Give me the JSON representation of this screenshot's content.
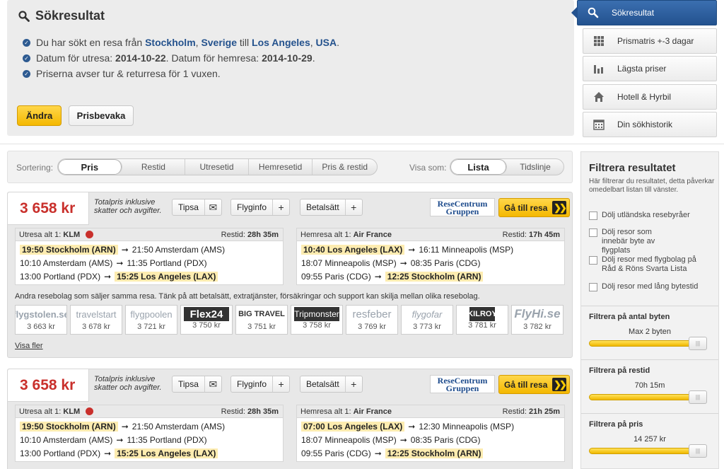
{
  "summary": {
    "title": "Sökresultat",
    "line1": {
      "prefix": "Du har sökt en resa från ",
      "from_city": "Stockholm",
      "comma1": ", ",
      "from_country": "Sverige",
      "mid": " till ",
      "to_city": "Los Angeles",
      "comma2": ", ",
      "to_country": "USA",
      "suffix": "."
    },
    "line2": {
      "prefix": "Datum för utresa: ",
      "out_date": "2014-10-22",
      "mid": ". Datum för hemresa: ",
      "home_date": "2014-10-29",
      "suffix": "."
    },
    "line3": "Priserna avser tur & returresa för 1 vuxen.",
    "change_label": "Ändra",
    "watch_label": "Prisbevaka"
  },
  "nav": [
    {
      "label": "Sökresultat",
      "icon": "search-icon"
    },
    {
      "label": "Prismatris +-3 dagar",
      "icon": "grid-icon"
    },
    {
      "label": "Lägsta priser",
      "icon": "bar-chart-icon"
    },
    {
      "label": "Hotell & Hyrbil",
      "icon": "house-icon"
    },
    {
      "label": "Din sökhistorik",
      "icon": "calendar-icon"
    }
  ],
  "sort": {
    "label": "Sortering:",
    "options": [
      "Pris",
      "Restid",
      "Utresetid",
      "Hemresetid",
      "Pris & restid"
    ],
    "view_label": "Visa som:",
    "view_options": [
      "Lista",
      "Tidslinje"
    ]
  },
  "results": [
    {
      "price": "3 658 kr",
      "note": "Totalpris inklusive skatter och avgifter.",
      "tipsa": "Tipsa",
      "flyginfo": "Flyginfo",
      "betalsatt": "Betalsätt",
      "agency_logo": "ReseCentrum Gruppen",
      "go_label": "Gå till resa",
      "out": {
        "head": "Utresa alt 1:",
        "airline": "KLM",
        "time_label": "Restid:",
        "time": "28h 35m",
        "rows": [
          {
            "dep": "19:50 Stockholm (ARN)",
            "arr": "21:50 Amsterdam (AMS)"
          },
          {
            "dep": "10:10 Amsterdam (AMS)",
            "arr": "11:35 Portland (PDX)"
          },
          {
            "dep": "13:00 Portland (PDX)",
            "arr": "15:25 Los Angeles (LAX)"
          }
        ]
      },
      "home": {
        "head": "Hemresa alt 1:",
        "airline": "Air France",
        "time_label": "Restid:",
        "time": "17h 45m",
        "rows": [
          {
            "dep": "10:40 Los Angeles (LAX)",
            "arr": "16:11 Minneapolis (MSP)"
          },
          {
            "dep": "18:07 Minneapolis (MSP)",
            "arr": "08:35 Paris (CDG)"
          },
          {
            "dep": "09:55 Paris (CDG)",
            "arr": "12:25 Stockholm (ARN)"
          }
        ]
      },
      "other_text": "Andra resebolag som säljer samma resa. Tänk på att betalsätt, extratjänster, försäkringar och support kan skilja mellan olika resebolag.",
      "others": [
        {
          "name": "flygstolen.se",
          "price": "3 663 kr"
        },
        {
          "name": "travelstart",
          "price": "3 678 kr"
        },
        {
          "name": "flygpoolen",
          "price": "3 721 kr"
        },
        {
          "name": "Flex24",
          "price": "3 750 kr"
        },
        {
          "name": "BIG TRAVEL",
          "price": "3 751 kr"
        },
        {
          "name": "Tripmonster",
          "price": "3 758 kr"
        },
        {
          "name": "resfeber",
          "price": "3 769 kr"
        },
        {
          "name": "flygofar",
          "price": "3 773 kr"
        },
        {
          "name": "KILROY",
          "price": "3 781 kr"
        },
        {
          "name": "FlyHi.se",
          "price": "3 782 kr"
        }
      ],
      "more_label": "Visa fler"
    },
    {
      "price": "3 658 kr",
      "note": "Totalpris inklusive skatter och avgifter.",
      "tipsa": "Tipsa",
      "flyginfo": "Flyginfo",
      "betalsatt": "Betalsätt",
      "agency_logo": "ReseCentrum Gruppen",
      "go_label": "Gå till resa",
      "out": {
        "head": "Utresa alt 1:",
        "airline": "KLM",
        "time_label": "Restid:",
        "time": "28h 35m",
        "rows": [
          {
            "dep": "19:50 Stockholm (ARN)",
            "arr": "21:50 Amsterdam (AMS)"
          },
          {
            "dep": "10:10 Amsterdam (AMS)",
            "arr": "11:35 Portland (PDX)"
          },
          {
            "dep": "13:00 Portland (PDX)",
            "arr": "15:25 Los Angeles (LAX)"
          }
        ]
      },
      "home": {
        "head": "Hemresa alt 1:",
        "airline": "Air France",
        "time_label": "Restid:",
        "time": "21h 25m",
        "rows": [
          {
            "dep": "07:00 Los Angeles (LAX)",
            "arr": "12:30 Minneapolis (MSP)"
          },
          {
            "dep": "18:07 Minneapolis (MSP)",
            "arr": "08:35 Paris (CDG)"
          },
          {
            "dep": "09:55 Paris (CDG)",
            "arr": "12:25 Stockholm (ARN)"
          }
        ]
      }
    }
  ],
  "filter": {
    "title": "Filtrera resultatet",
    "desc": "Här filtrerar du resultatet, detta påverkar omedelbart listan till vänster.",
    "checks": [
      "Dölj utländska resebyråer",
      "Dölj resor som innebär byte av flygplats",
      "Dölj resor med flygbolag på Råd & Röns Svarta Lista",
      "Dölj resor med lång bytestid"
    ],
    "stops": {
      "label": "Filtrera på antal byten",
      "value": "Max 2 byten"
    },
    "duration": {
      "label": "Filtrera på restid",
      "value": "70h 15m"
    },
    "price": {
      "label": "Filtrera på pris",
      "value": "14 257 kr"
    }
  }
}
